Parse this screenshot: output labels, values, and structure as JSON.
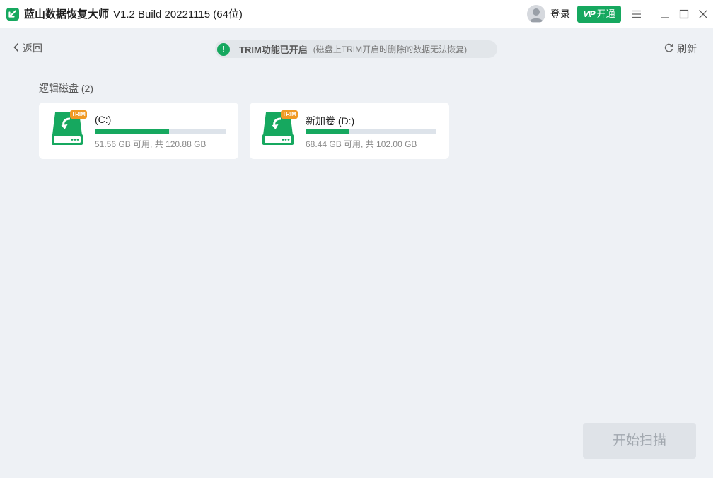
{
  "app": {
    "name": "蓝山数据恢复大师",
    "version": "V1.2 Build 20221115 (64位)"
  },
  "titlebar": {
    "login_label": "登录",
    "vip_icon_text": "VIP",
    "vip_label": "开通"
  },
  "toolbar": {
    "back_label": "返回",
    "trim_status_title": "TRIM功能已开启",
    "trim_status_note": "(磁盘上TRIM开启时删除的数据无法恢复)",
    "refresh_label": "刷新"
  },
  "section": {
    "title": "逻辑磁盘 (2)"
  },
  "disks": [
    {
      "badge": "TRIM",
      "name": "(C:)",
      "size_text": "51.56 GB 可用, 共 120.88 GB",
      "used_fraction": 0.57
    },
    {
      "badge": "TRIM",
      "name": "新加卷 (D:)",
      "size_text": "68.44 GB 可用, 共 102.00 GB",
      "used_fraction": 0.33
    }
  ],
  "actions": {
    "start_scan_label": "开始扫描"
  },
  "colors": {
    "brand_green": "#16a85f",
    "trim_badge_orange": "#f09a24",
    "background": "#eef1f5"
  }
}
